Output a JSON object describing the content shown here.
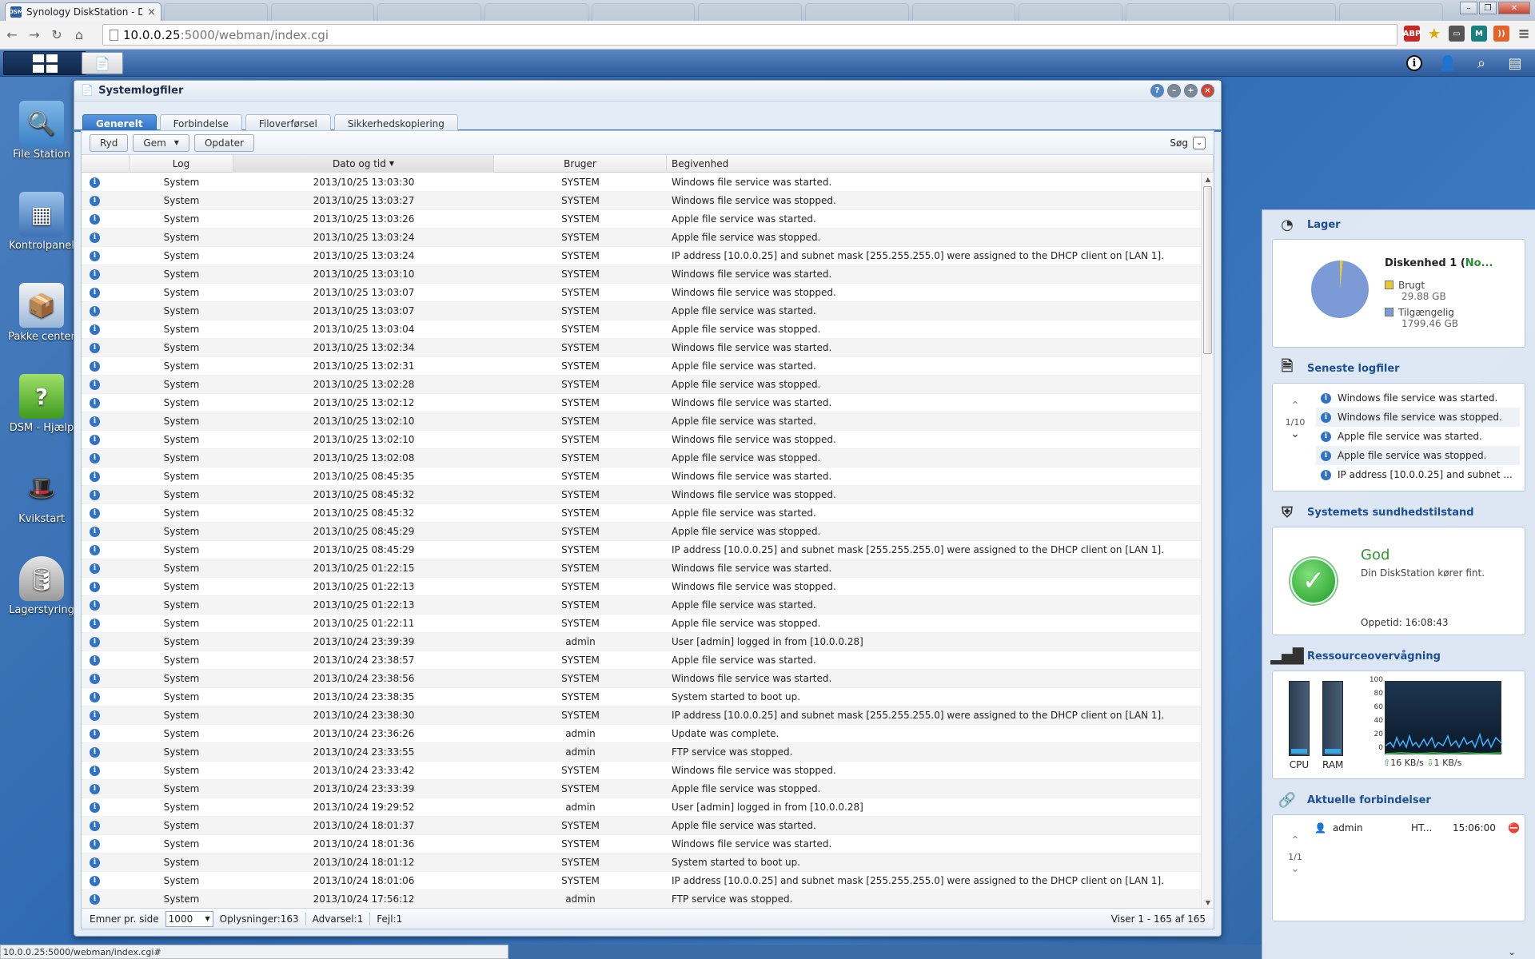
{
  "browser": {
    "tab_title": "Synology DiskStation - Di",
    "tab_favicon": "DSM",
    "url_host": "10.0.0.25",
    "url_path": ":5000/webman/index.cgi",
    "status_url": "10.0.0.25:5000/webman/index.cgi#"
  },
  "desktop_icons": [
    {
      "label": "File Station",
      "icon": "magnifier-folder-icon"
    },
    {
      "label": "Kontrolpanel",
      "icon": "control-panel-icon"
    },
    {
      "label": "Pakke center",
      "icon": "package-icon"
    },
    {
      "label": "DSM - Hjælp",
      "icon": "help-book-icon"
    },
    {
      "label": "Kvikstart",
      "icon": "magic-hat-icon"
    },
    {
      "label": "Lagerstyring",
      "icon": "storage-cylinder-icon"
    }
  ],
  "log_window": {
    "title": "Systemlogfiler",
    "tabs": [
      "Generelt",
      "Forbindelse",
      "Filoverførsel",
      "Sikkerhedskopiering"
    ],
    "active_tab": "Generelt",
    "actions": {
      "clear": "Ryd",
      "save": "Gem",
      "refresh": "Opdater",
      "search": "Søg"
    },
    "columns": {
      "log": "Log",
      "date": "Dato og tid",
      "user": "Bruger",
      "event": "Begivenhed"
    },
    "rows": [
      {
        "log": "System",
        "date": "2013/10/25 13:03:30",
        "user": "SYSTEM",
        "event": "Windows file service was started."
      },
      {
        "log": "System",
        "date": "2013/10/25 13:03:27",
        "user": "SYSTEM",
        "event": "Windows file service was stopped."
      },
      {
        "log": "System",
        "date": "2013/10/25 13:03:26",
        "user": "SYSTEM",
        "event": "Apple file service was started."
      },
      {
        "log": "System",
        "date": "2013/10/25 13:03:24",
        "user": "SYSTEM",
        "event": "Apple file service was stopped."
      },
      {
        "log": "System",
        "date": "2013/10/25 13:03:24",
        "user": "SYSTEM",
        "event": "IP address [10.0.0.25] and subnet mask [255.255.255.0] were assigned to the DHCP client on [LAN 1]."
      },
      {
        "log": "System",
        "date": "2013/10/25 13:03:10",
        "user": "SYSTEM",
        "event": "Windows file service was started."
      },
      {
        "log": "System",
        "date": "2013/10/25 13:03:07",
        "user": "SYSTEM",
        "event": "Windows file service was stopped."
      },
      {
        "log": "System",
        "date": "2013/10/25 13:03:07",
        "user": "SYSTEM",
        "event": "Apple file service was started."
      },
      {
        "log": "System",
        "date": "2013/10/25 13:03:04",
        "user": "SYSTEM",
        "event": "Apple file service was stopped."
      },
      {
        "log": "System",
        "date": "2013/10/25 13:02:34",
        "user": "SYSTEM",
        "event": "Windows file service was started."
      },
      {
        "log": "System",
        "date": "2013/10/25 13:02:31",
        "user": "SYSTEM",
        "event": "Apple file service was started."
      },
      {
        "log": "System",
        "date": "2013/10/25 13:02:28",
        "user": "SYSTEM",
        "event": "Apple file service was stopped."
      },
      {
        "log": "System",
        "date": "2013/10/25 13:02:12",
        "user": "SYSTEM",
        "event": "Windows file service was started."
      },
      {
        "log": "System",
        "date": "2013/10/25 13:02:10",
        "user": "SYSTEM",
        "event": "Apple file service was started."
      },
      {
        "log": "System",
        "date": "2013/10/25 13:02:10",
        "user": "SYSTEM",
        "event": "Windows file service was stopped."
      },
      {
        "log": "System",
        "date": "2013/10/25 13:02:08",
        "user": "SYSTEM",
        "event": "Apple file service was stopped."
      },
      {
        "log": "System",
        "date": "2013/10/25 08:45:35",
        "user": "SYSTEM",
        "event": "Windows file service was started."
      },
      {
        "log": "System",
        "date": "2013/10/25 08:45:32",
        "user": "SYSTEM",
        "event": "Windows file service was stopped."
      },
      {
        "log": "System",
        "date": "2013/10/25 08:45:32",
        "user": "SYSTEM",
        "event": "Apple file service was started."
      },
      {
        "log": "System",
        "date": "2013/10/25 08:45:29",
        "user": "SYSTEM",
        "event": "Apple file service was stopped."
      },
      {
        "log": "System",
        "date": "2013/10/25 08:45:29",
        "user": "SYSTEM",
        "event": "IP address [10.0.0.25] and subnet mask [255.255.255.0] were assigned to the DHCP client on [LAN 1]."
      },
      {
        "log": "System",
        "date": "2013/10/25 01:22:15",
        "user": "SYSTEM",
        "event": "Windows file service was started."
      },
      {
        "log": "System",
        "date": "2013/10/25 01:22:13",
        "user": "SYSTEM",
        "event": "Windows file service was stopped."
      },
      {
        "log": "System",
        "date": "2013/10/25 01:22:13",
        "user": "SYSTEM",
        "event": "Apple file service was started."
      },
      {
        "log": "System",
        "date": "2013/10/25 01:22:11",
        "user": "SYSTEM",
        "event": "Apple file service was stopped."
      },
      {
        "log": "System",
        "date": "2013/10/24 23:39:39",
        "user": "admin",
        "event": "User [admin] logged in from [10.0.0.28]"
      },
      {
        "log": "System",
        "date": "2013/10/24 23:38:57",
        "user": "SYSTEM",
        "event": "Apple file service was started."
      },
      {
        "log": "System",
        "date": "2013/10/24 23:38:56",
        "user": "SYSTEM",
        "event": "Windows file service was started."
      },
      {
        "log": "System",
        "date": "2013/10/24 23:38:35",
        "user": "SYSTEM",
        "event": "System started to boot up."
      },
      {
        "log": "System",
        "date": "2013/10/24 23:38:30",
        "user": "SYSTEM",
        "event": "IP address [10.0.0.25] and subnet mask [255.255.255.0] were assigned to the DHCP client on [LAN 1]."
      },
      {
        "log": "System",
        "date": "2013/10/24 23:36:26",
        "user": "admin",
        "event": "Update was complete."
      },
      {
        "log": "System",
        "date": "2013/10/24 23:33:55",
        "user": "admin",
        "event": "FTP service was stopped."
      },
      {
        "log": "System",
        "date": "2013/10/24 23:33:42",
        "user": "SYSTEM",
        "event": "Windows file service was stopped."
      },
      {
        "log": "System",
        "date": "2013/10/24 23:33:39",
        "user": "SYSTEM",
        "event": "Apple file service was stopped."
      },
      {
        "log": "System",
        "date": "2013/10/24 19:29:52",
        "user": "admin",
        "event": "User [admin] logged in from [10.0.0.28]"
      },
      {
        "log": "System",
        "date": "2013/10/24 18:01:37",
        "user": "SYSTEM",
        "event": "Apple file service was started."
      },
      {
        "log": "System",
        "date": "2013/10/24 18:01:36",
        "user": "SYSTEM",
        "event": "Windows file service was started."
      },
      {
        "log": "System",
        "date": "2013/10/24 18:01:12",
        "user": "SYSTEM",
        "event": "System started to boot up."
      },
      {
        "log": "System",
        "date": "2013/10/24 18:01:06",
        "user": "SYSTEM",
        "event": "IP address [10.0.0.25] and subnet mask [255.255.255.0] were assigned to the DHCP client on [LAN 1]."
      },
      {
        "log": "System",
        "date": "2013/10/24 17:56:12",
        "user": "admin",
        "event": "FTP service was stopped."
      }
    ],
    "footer": {
      "per_page_label": "Emner pr. side",
      "per_page_value": "1000",
      "info": "Oplysninger:163",
      "warning": "Advarsel:1",
      "error": "Fejl:1",
      "range": "Viser 1 - 165 af 165"
    }
  },
  "widgets": {
    "storage": {
      "title": "Lager",
      "disk_name": "Diskenhed 1 (",
      "disk_status": "No...",
      "used_label": "Brugt",
      "used_value": "29.88 GB",
      "available_label": "Tilgængelig",
      "available_value": "1799.46 GB",
      "used_color": "#e7c73a",
      "available_color": "#7b9ad6"
    },
    "recent_logs": {
      "title": "Seneste logfiler",
      "page": "1/10",
      "items": [
        "Windows file service was started.",
        "Windows file service was stopped.",
        "Apple file service was started.",
        "Apple file service was stopped.",
        "IP address [10.0.0.25] and subnet ..."
      ]
    },
    "health": {
      "title": "Systemets sundhedstilstand",
      "status": "God",
      "message": "Din DiskStation kører fint.",
      "uptime": "Oppetid: 16:08:43"
    },
    "resources": {
      "title": "Ressourceovervågning",
      "cpu_label": "CPU",
      "ram_label": "RAM",
      "cpu_percent": 6,
      "ram_percent": 6,
      "y_ticks": [
        "100",
        "80",
        "60",
        "40",
        "20",
        "0"
      ],
      "upload": "16 KB/s",
      "download": "1 KB/s"
    },
    "connections": {
      "title": "Aktuelle forbindelser",
      "page": "1/1",
      "user": "admin",
      "type": "HT...",
      "time": "15:06:00"
    }
  }
}
